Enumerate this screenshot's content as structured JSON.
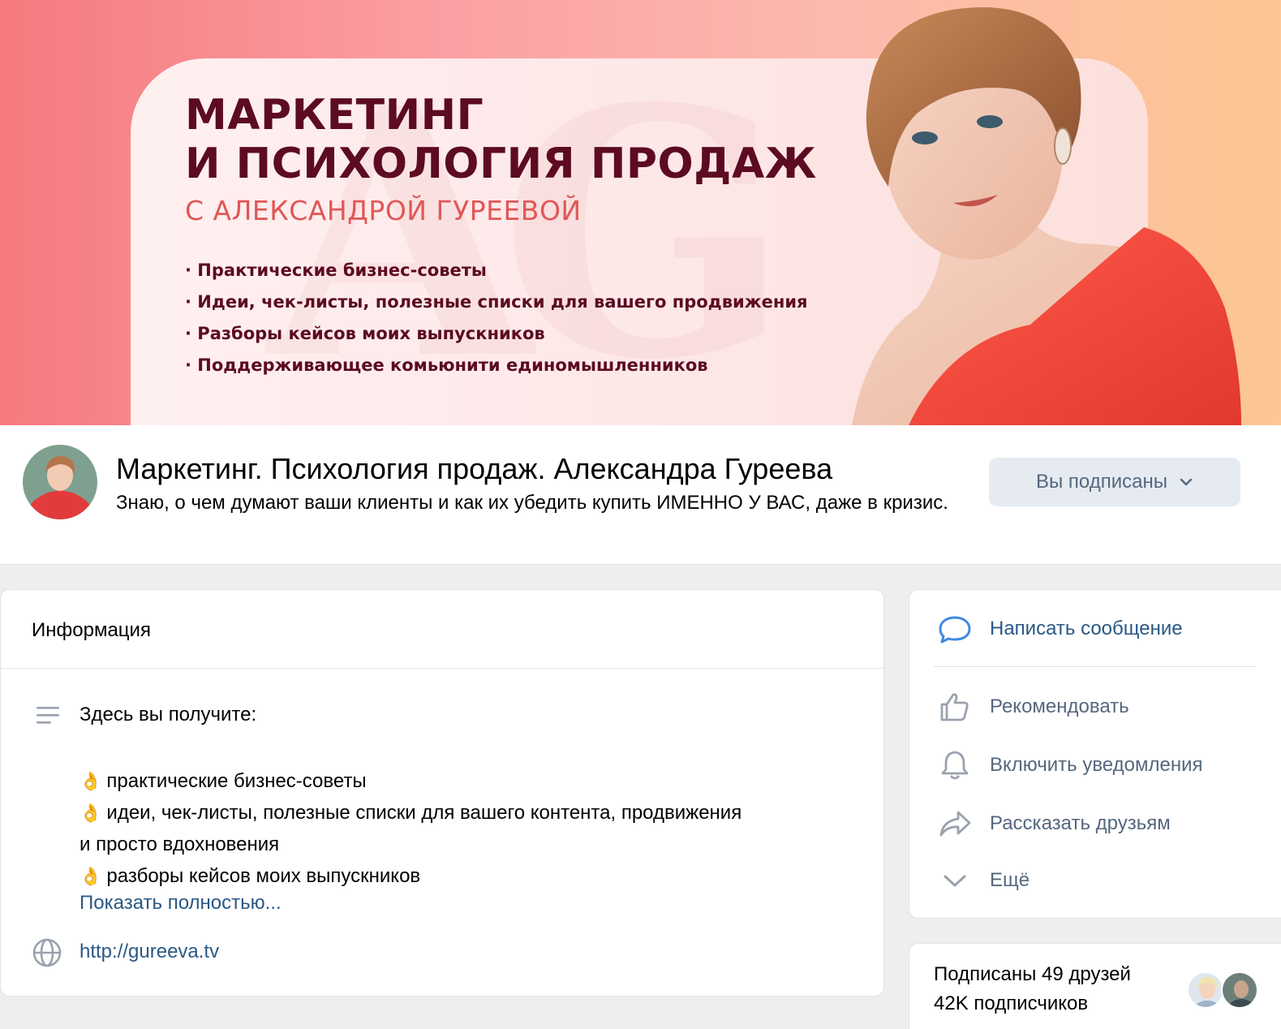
{
  "cover": {
    "title_line1": "МАРКЕТИНГ",
    "title_line2": "И ПСИХОЛОГИЯ ПРОДАЖ",
    "subtitle": "С АЛЕКСАНДРОЙ ГУРЕЕВОЙ",
    "watermark": "AG",
    "bullets": [
      "Практические бизнес-советы",
      "Идеи, чек-листы, полезные списки для вашего продвижения",
      "Разборы кейсов моих выпускников",
      "Поддерживающее комьюнити единомышленников"
    ]
  },
  "header": {
    "name": "Маркетинг. Психология продаж. Александра Гуреева",
    "status": "Знаю, о чем думают ваши клиенты и как их убедить купить ИМЕННО У ВАС, даже в кризис.",
    "subscribed_label": "Вы подписаны",
    "subscribed_icon": "chevron-down-icon"
  },
  "info": {
    "title": "Информация",
    "description_heading": "Здесь вы получите:",
    "description_lines": [
      {
        "emoji": "👌",
        "text": "практические бизнес-советы"
      },
      {
        "emoji": "👌",
        "text": "идеи, чек-листы, полезные списки для вашего контента, продвижения"
      },
      {
        "emoji": "",
        "text": "и просто вдохновения"
      },
      {
        "emoji": "👌",
        "text": "разборы кейсов моих выпускников"
      }
    ],
    "show_more": "Показать полностью...",
    "website": "http://gureeva.tv"
  },
  "actions": {
    "items": [
      {
        "label": "Написать сообщение",
        "icon": "message-icon"
      },
      {
        "label": "Рекомендовать",
        "icon": "thumbs-up-icon"
      },
      {
        "label": "Включить уведомления",
        "icon": "bell-icon"
      },
      {
        "label": "Рассказать друзьям",
        "icon": "share-icon"
      },
      {
        "label": "Ещё",
        "icon": "chevron-down-icon"
      }
    ]
  },
  "followers": {
    "friends": "Подписаны 49 друзей",
    "subscribers": "42K подписчиков"
  },
  "colors": {
    "link": "#2a5885",
    "muted": "#55677d",
    "cover_title": "#5c0b22",
    "cover_subtitle": "#e15757",
    "button_bg": "#e5ebf1"
  }
}
